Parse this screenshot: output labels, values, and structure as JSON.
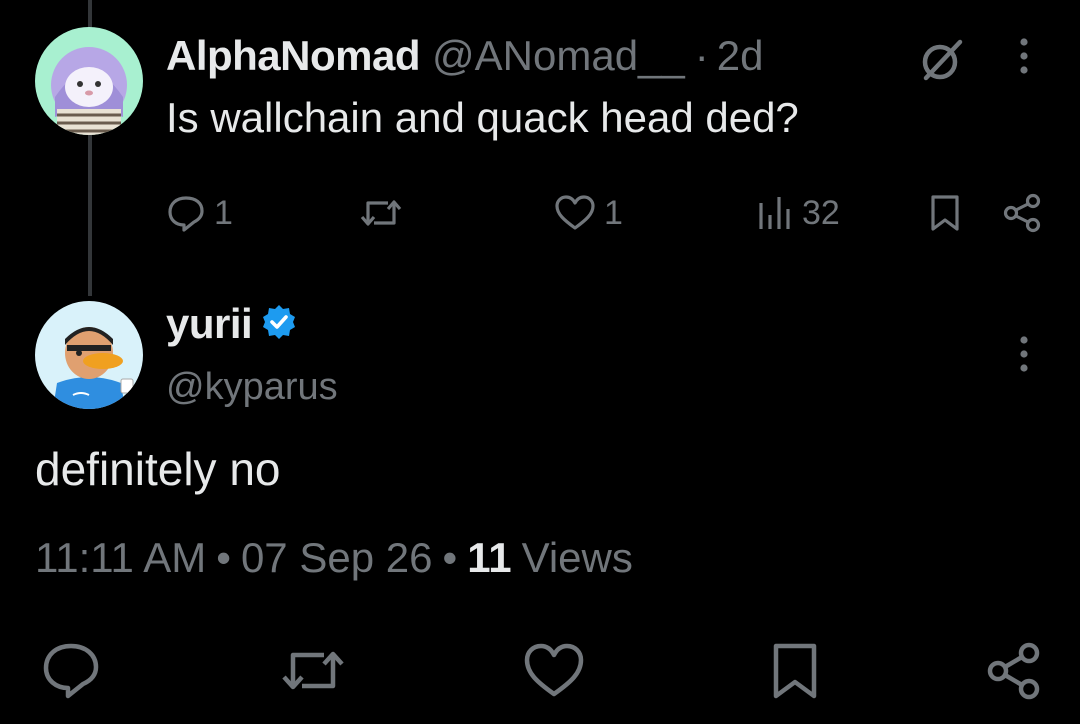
{
  "colors": {
    "background": "#000000",
    "text_primary": "#e7e9ea",
    "text_secondary": "#71767b",
    "thread_line": "#333639",
    "verified": "#1d9bf0"
  },
  "parent_post": {
    "author_name": "AlphaNomad",
    "author_handle": "@ANomad__",
    "separator": "·",
    "time_ago": "2d",
    "text": "Is wallchain and quack head ded?",
    "avatar_icon": "hooded-character-avatar",
    "actions": {
      "reply_count": "1",
      "repost_count": "",
      "like_count": "1",
      "views_count": "32"
    }
  },
  "reply_post": {
    "author_name": "yurii",
    "verified": true,
    "author_handle": "@kyparus",
    "avatar_icon": "duck-bill-character-avatar",
    "text": "definitely no",
    "time": "11:11 AM",
    "separator": "•",
    "date": "07 Sep 26",
    "views_count": "11",
    "views_label": "Views"
  },
  "icons": {
    "reply": "comment-icon",
    "repost": "repost-icon",
    "like": "heart-icon",
    "views": "analytics-icon",
    "bookmark": "bookmark-icon",
    "share": "share-icon",
    "grok": "grok-icon",
    "more": "more-vertical-icon"
  }
}
